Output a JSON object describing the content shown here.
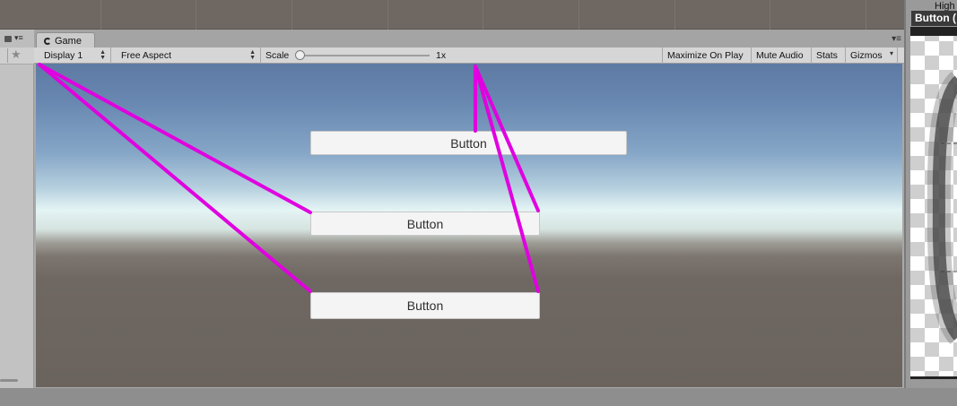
{
  "game_window": {
    "tab_label": "Game",
    "toolbar": {
      "display": "Display 1",
      "aspect": "Free Aspect",
      "scale_label": "Scale",
      "scale_value": "1x",
      "maximize_on_play": "Maximize On Play",
      "mute_audio": "Mute Audio",
      "stats": "Stats",
      "gizmos": "Gizmos"
    },
    "buttons": [
      "Button",
      "Button",
      "Button"
    ]
  },
  "right_panel": {
    "header_text": "High",
    "title": "Button ("
  },
  "colors": {
    "connection_line": "#e000e0",
    "sky_top": "#5e7aa3",
    "horizon": "#e4f4f4",
    "ground": "#6a635e"
  },
  "icons": {
    "lock": "lock-icon",
    "menu": "panel-menu-icon",
    "star": "star-icon",
    "game": "game-controller-icon"
  }
}
